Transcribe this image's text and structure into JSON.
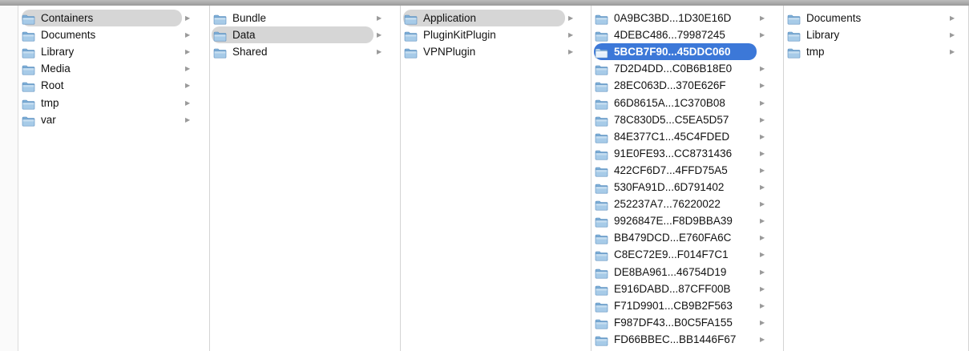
{
  "columns": [
    {
      "items": [
        {
          "label": "Containers",
          "state": "gray"
        },
        {
          "label": "Documents",
          "state": "none"
        },
        {
          "label": "Library",
          "state": "none"
        },
        {
          "label": "Media",
          "state": "none"
        },
        {
          "label": "Root",
          "state": "none"
        },
        {
          "label": "tmp",
          "state": "none"
        },
        {
          "label": "var",
          "state": "none"
        }
      ]
    },
    {
      "items": [
        {
          "label": "Bundle",
          "state": "none"
        },
        {
          "label": "Data",
          "state": "gray"
        },
        {
          "label": "Shared",
          "state": "none"
        }
      ]
    },
    {
      "items": [
        {
          "label": "Application",
          "state": "gray"
        },
        {
          "label": "PluginKitPlugin",
          "state": "none"
        },
        {
          "label": "VPNPlugin",
          "state": "none"
        }
      ]
    },
    {
      "items": [
        {
          "label": "0A9BC3BD...1D30E16D",
          "state": "none"
        },
        {
          "label": "4DEBC486...79987245",
          "state": "none"
        },
        {
          "label": "5BCB7F90...45DDC060",
          "state": "blue"
        },
        {
          "label": "7D2D4DD...C0B6B18E0",
          "state": "none"
        },
        {
          "label": "28EC063D...370E626F",
          "state": "none"
        },
        {
          "label": "66D8615A...1C370B08",
          "state": "none"
        },
        {
          "label": "78C830D5...C5EA5D57",
          "state": "none"
        },
        {
          "label": "84E377C1...45C4FDED",
          "state": "none"
        },
        {
          "label": "91E0FE93...CC8731436",
          "state": "none"
        },
        {
          "label": "422CF6D7...4FFD75A5",
          "state": "none"
        },
        {
          "label": "530FA91D...6D791402",
          "state": "none"
        },
        {
          "label": "252237A7...76220022",
          "state": "none"
        },
        {
          "label": "9926847E...F8D9BBA39",
          "state": "none"
        },
        {
          "label": "BB479DCD...E760FA6C",
          "state": "none"
        },
        {
          "label": "C8EC72E9...F014F7C1",
          "state": "none"
        },
        {
          "label": "DE8BA961...46754D19",
          "state": "none"
        },
        {
          "label": "E916DABD...87CFF00B",
          "state": "none"
        },
        {
          "label": "F71D9901...CB9B2F563",
          "state": "none"
        },
        {
          "label": "F987DF43...B0C5FA155",
          "state": "none"
        },
        {
          "label": "FD66BBEC...BB1446F67",
          "state": "none"
        }
      ]
    },
    {
      "items": [
        {
          "label": "Documents",
          "state": "none"
        },
        {
          "label": "Library",
          "state": "none"
        },
        {
          "label": "tmp",
          "state": "none"
        }
      ]
    }
  ],
  "icons": {
    "folder": "folder-icon",
    "disclosure": "chevron-right-icon"
  },
  "colors": {
    "selection_blue": "#3c78d8",
    "selection_gray": "#d6d6d6",
    "folder_fill": "#a7cbe8",
    "folder_tab": "#7fb0d8"
  }
}
